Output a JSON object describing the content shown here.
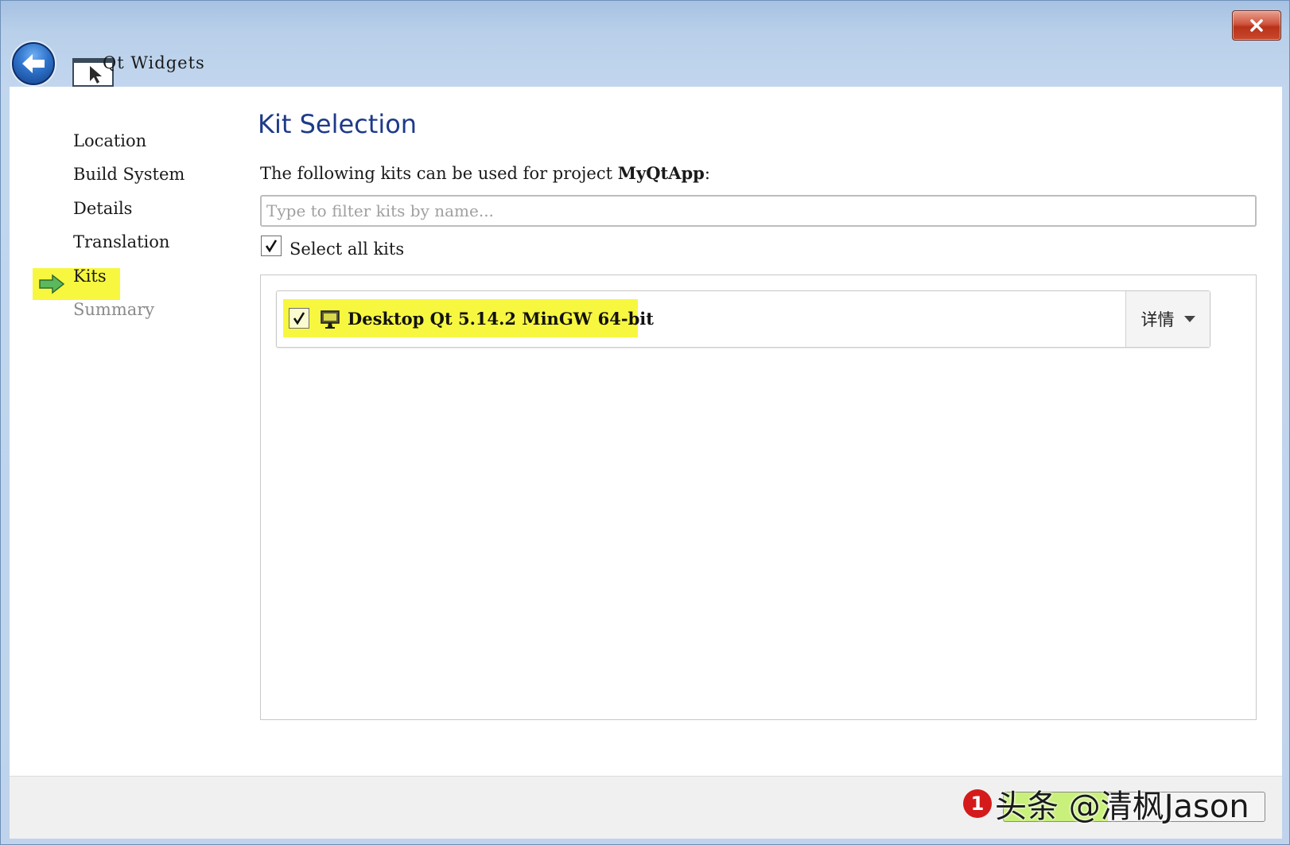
{
  "window": {
    "title": "Qt Widgets",
    "close_glyph": "✕"
  },
  "nav": {
    "items": [
      {
        "label": "Location",
        "state": "done"
      },
      {
        "label": "Build System",
        "state": "done"
      },
      {
        "label": "Details",
        "state": "done"
      },
      {
        "label": "Translation",
        "state": "done"
      },
      {
        "label": "Kits",
        "state": "current"
      },
      {
        "label": "Summary",
        "state": "pending"
      }
    ]
  },
  "page": {
    "title": "Kit Selection",
    "description_prefix": "The following kits can be used for project ",
    "project_name": "MyQtApp",
    "description_suffix": ":",
    "filter_placeholder": "Type to filter kits by name...",
    "filter_value": "",
    "select_all_label": "Select all kits",
    "select_all_checked": true
  },
  "kits": [
    {
      "name": "Desktop Qt 5.14.2 MinGW 64-bit",
      "checked": true,
      "details_label": "详情",
      "icon": "monitor-icon"
    }
  ],
  "watermark": {
    "badge": "1",
    "text": "头条 @清枫Jason"
  },
  "colors": {
    "highlight": "#f7f740",
    "title_blue": "#1e3a8a",
    "nav_arrow": "#4caf50"
  }
}
